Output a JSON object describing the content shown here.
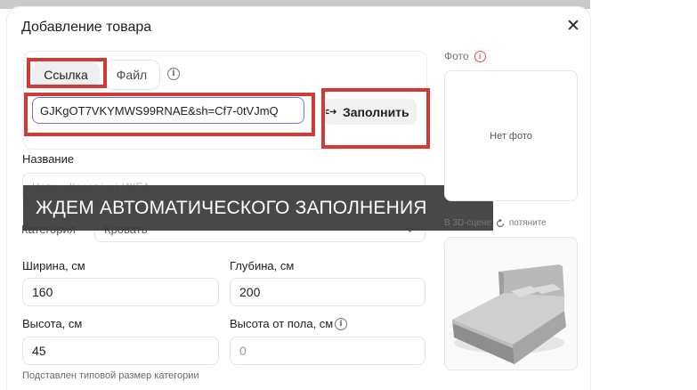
{
  "dialog": {
    "title": "Добавление товара",
    "close_symbol": "✕"
  },
  "source_tabs": {
    "link_label": "Ссылка",
    "file_label": "Файл",
    "info_symbol": "i"
  },
  "url_field": {
    "value": "GJKgOT7VKYMWS99RNAE&sh=Cf7-0tVJmQ"
  },
  "fill_button": {
    "label": "Заполнить",
    "icon": "link-arrow-icon"
  },
  "name_field": {
    "label": "Название",
    "placeholder": "Напр. «Кресло из ИКЕА»"
  },
  "overlay": {
    "text": "ЖДЕМ АВТОМАТИЧЕСКОГО ЗАПОЛНЕНИЯ"
  },
  "category_field": {
    "label": "Категория",
    "value": "Кровать"
  },
  "dimensions": {
    "width_label": "Ширина, см",
    "width_value": "160",
    "depth_label": "Глубина, см",
    "depth_value": "200",
    "height_label": "Высота, см",
    "height_value": "45",
    "floor_height_label": "Высота от пола, см",
    "floor_height_value": "0",
    "hint": "Подставлен типовой размер категории"
  },
  "photo": {
    "label": "Фото",
    "empty_text": "Нет фото",
    "warning_symbol": "i"
  },
  "scene": {
    "label": "В 3D-сцене",
    "rotate_hint": "потяните",
    "preview_icon": "bed-3d-preview"
  },
  "colors": {
    "highlight_red": "#d23b35",
    "input_focus": "#6f75e0",
    "overlay_bg": "#3a3a3a"
  }
}
